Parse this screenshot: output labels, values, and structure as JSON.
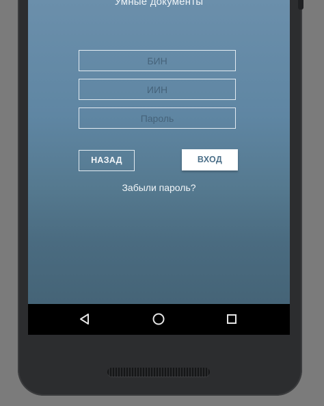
{
  "app": {
    "title": "Умные документы"
  },
  "form": {
    "bin_placeholder": "БИН",
    "iin_placeholder": "ИИН",
    "password_placeholder": "Пароль",
    "bin_value": "",
    "iin_value": "",
    "password_value": ""
  },
  "buttons": {
    "back_label": "НАЗАД",
    "login_label": "ВХОД"
  },
  "links": {
    "forgot_password": "Забыли пароль?"
  },
  "navbar": {
    "back_icon": "triangle-back-icon",
    "home_icon": "circle-home-icon",
    "recent_icon": "square-recent-icon"
  },
  "colors": {
    "screen_top": "#6b8fab",
    "screen_bottom": "#456477",
    "login_button_bg": "#ffffff",
    "login_button_text": "#4b6f88",
    "navbar_bg": "#000000",
    "phone_body": "#2c2d2f"
  }
}
